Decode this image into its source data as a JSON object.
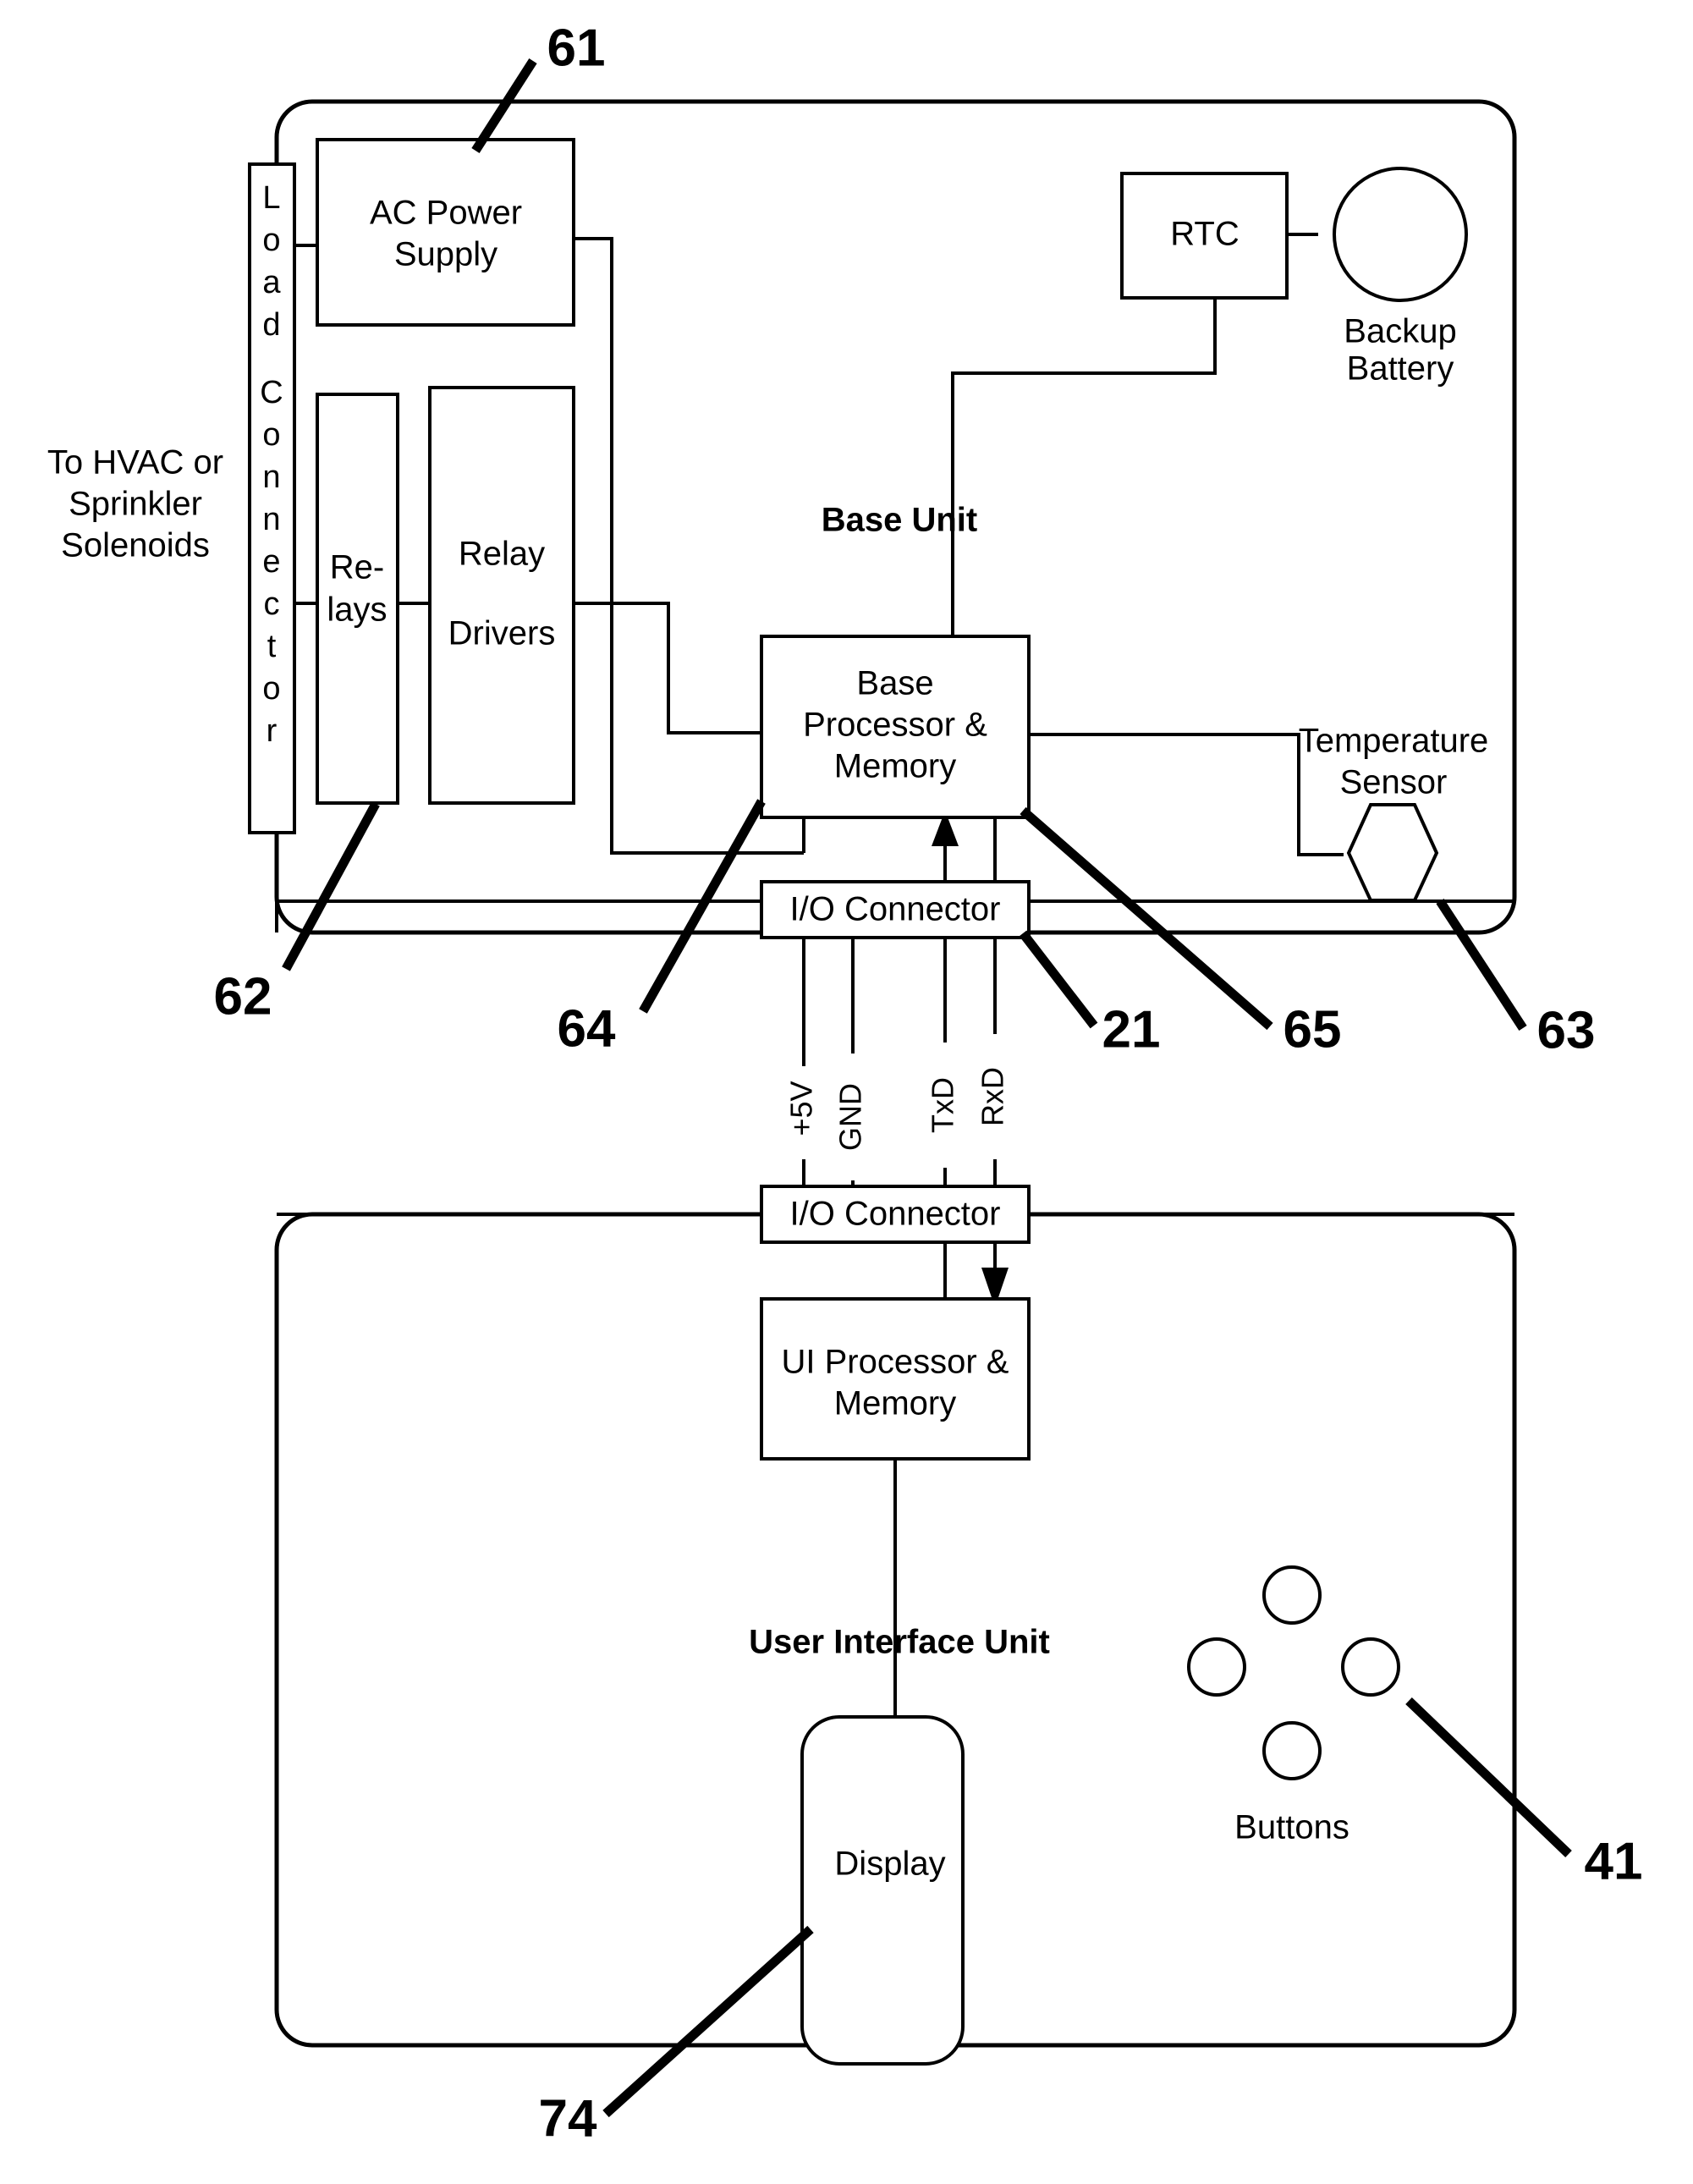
{
  "figure": {
    "type": "patent-block-diagram",
    "background_color": "#ffffff",
    "line_color": "#000000"
  },
  "external_labels": {
    "hvac_note_line1": "To HVAC or",
    "hvac_note_line2": "Sprinkler",
    "hvac_note_line3": "Solenoids"
  },
  "base_unit": {
    "caption": "Base Unit",
    "reference_numerals": {
      "ac_power_supply": "61",
      "relays": "62",
      "base_processor": "64",
      "io_connector": "21",
      "rtc": "65",
      "temperature_sensor": "63"
    },
    "blocks": {
      "load_connector": {
        "label": "Load Connector",
        "letters": [
          "L",
          "o",
          "a",
          "d",
          "",
          "C",
          "o",
          "n",
          "n",
          "e",
          "c",
          "t",
          "o",
          "r"
        ]
      },
      "ac_power_supply": {
        "line1": "AC Power",
        "line2": "Supply"
      },
      "relays": {
        "line1": "Re-",
        "line2": "lays"
      },
      "relay_drivers": {
        "line1": "Relay",
        "line2": "Drivers"
      },
      "base_processor": {
        "line1": "Base",
        "line2": "Processor &",
        "line3": "Memory"
      },
      "rtc": {
        "label": "RTC"
      },
      "backup_battery": {
        "line1": "Backup",
        "line2": "Battery"
      },
      "temperature_sensor": {
        "line1": "Temperature",
        "line2": "Sensor"
      },
      "io_connector": {
        "label": "I/O Connector"
      }
    }
  },
  "interconnect": {
    "signals": [
      "+5V",
      "GND",
      "TxD",
      "RxD"
    ]
  },
  "user_interface_unit": {
    "caption": "User Interface Unit",
    "reference_numerals": {
      "buttons": "41",
      "display": "74"
    },
    "blocks": {
      "io_connector": {
        "label": "I/O Connector"
      },
      "ui_processor": {
        "line1": "UI Processor &",
        "line2": "Memory"
      },
      "display": {
        "label": "Display"
      },
      "buttons": {
        "label": "Buttons",
        "count": 4
      }
    }
  }
}
